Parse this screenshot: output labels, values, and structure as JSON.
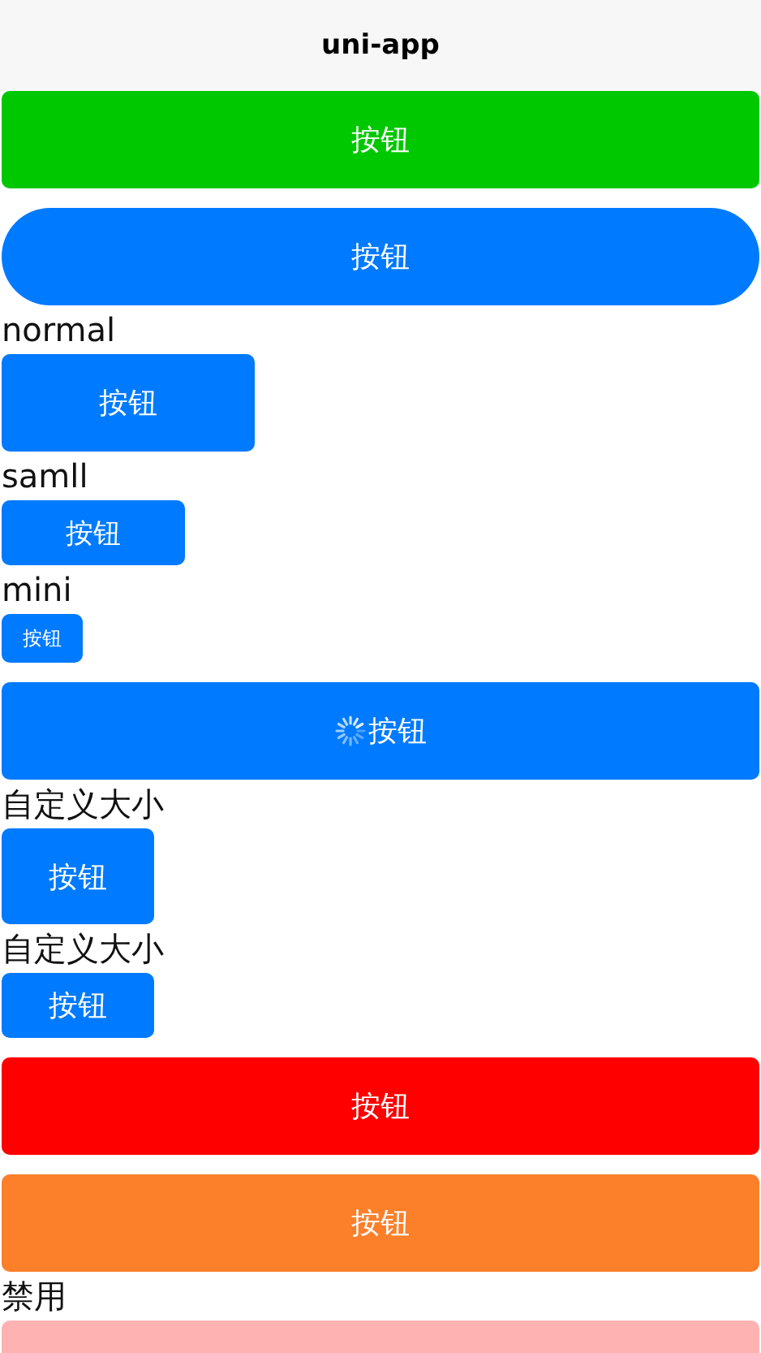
{
  "navbar": {
    "title": "uni-app"
  },
  "items": [
    {
      "kind": "wide",
      "label": "按钮",
      "color": "#00c800",
      "round": false,
      "loading": false
    },
    {
      "kind": "wide",
      "label": "按钮",
      "color": "#007aff",
      "round": true,
      "loading": false
    },
    {
      "kind": "caption",
      "text": "normal"
    },
    {
      "kind": "normal",
      "label": "按钮",
      "color": "#007aff",
      "round": false,
      "loading": false
    },
    {
      "kind": "caption",
      "text": "samll"
    },
    {
      "kind": "small",
      "label": "按钮",
      "color": "#007aff",
      "round": false,
      "loading": false
    },
    {
      "kind": "caption",
      "text": "mini"
    },
    {
      "kind": "mini",
      "label": "按钮",
      "color": "#007aff",
      "round": false,
      "loading": false
    },
    {
      "kind": "wide",
      "label": "按钮",
      "color": "#007aff",
      "round": false,
      "loading": true
    },
    {
      "kind": "caption",
      "text": "自定义大小"
    },
    {
      "kind": "tall",
      "label": "按钮",
      "color": "#007aff",
      "round": false,
      "loading": false
    },
    {
      "kind": "caption",
      "text": "自定义大小"
    },
    {
      "kind": "short",
      "label": "按钮",
      "color": "#007aff",
      "round": false,
      "loading": false
    },
    {
      "kind": "wide",
      "label": "按钮",
      "color": "#ff0000",
      "round": false,
      "loading": false
    },
    {
      "kind": "wide",
      "label": "按钮",
      "color": "#fc7f2a",
      "round": false,
      "loading": false
    },
    {
      "kind": "caption",
      "text": "禁用"
    },
    {
      "kind": "disabled",
      "color": "#ffb2b2",
      "round": false
    }
  ]
}
